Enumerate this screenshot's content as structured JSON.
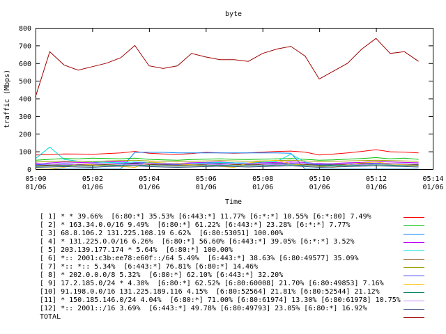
{
  "chart_data": {
    "type": "line",
    "title": "byte",
    "xlabel": "Time",
    "ylabel": "traffic (Mbps)",
    "ylim": [
      0,
      800
    ],
    "yticks": [
      "0",
      "100",
      "200",
      "300",
      "400",
      "500",
      "600",
      "700",
      "800"
    ],
    "xlim": [
      "05:00",
      "05:14"
    ],
    "xticks": [
      {
        "time": "05:00",
        "date": "01/06"
      },
      {
        "time": "05:02",
        "date": "01/06"
      },
      {
        "time": "05:04",
        "date": "01/06"
      },
      {
        "time": "05:06",
        "date": "01/06"
      },
      {
        "time": "05:08",
        "date": "01/06"
      },
      {
        "time": "05:10",
        "date": "01/06"
      },
      {
        "time": "05:12",
        "date": "01/06"
      },
      {
        "time": "05:14",
        "date": "01/06"
      }
    ],
    "grid": false,
    "legend_placement": "bottom",
    "x": [
      "05:00",
      "05:00:30",
      "05:01",
      "05:01:30",
      "05:02",
      "05:02:30",
      "05:03",
      "05:03:30",
      "05:04",
      "05:04:30",
      "05:05",
      "05:05:30",
      "05:06",
      "05:06:30",
      "05:07",
      "05:07:30",
      "05:08",
      "05:08:30",
      "05:09",
      "05:09:30",
      "05:10",
      "05:10:30",
      "05:11",
      "05:11:30",
      "05:12",
      "05:12:30",
      "05:13",
      "05:13:30"
    ],
    "series": [
      {
        "name": "[ 1] * * 39.66%  [6:80:*] 35.53% [6:443:*] 11.77% [6:*:*] 10.55% [6:*:80] 7.49%",
        "color": "#ff0000",
        "values": [
          80,
          82,
          86,
          85,
          84,
          88,
          92,
          100,
          90,
          86,
          83,
          88,
          95,
          92,
          90,
          92,
          96,
          100,
          102,
          96,
          80,
          85,
          92,
          100,
          110,
          98,
          96,
          92
        ]
      },
      {
        "name": "[ 2] * 163.34.0.0/16 9.49%  [6:80:*] 61.22% [6:443:*] 23.28% [6:*:*] 7.77%",
        "color": "#00c000",
        "values": [
          50,
          55,
          60,
          58,
          62,
          60,
          58,
          62,
          55,
          52,
          50,
          54,
          56,
          58,
          55,
          54,
          56,
          58,
          60,
          55,
          50,
          52,
          56,
          60,
          65,
          58,
          62,
          55
        ]
      },
      {
        "name": "[ 3] 68.8.106.2 131.225.108.19 6.62%  [6:80:53051] 100.00%",
        "color": "#0080ff",
        "values": [
          0,
          0,
          0,
          0,
          0,
          0,
          0,
          95,
          95,
          95,
          92,
          92,
          92,
          92,
          92,
          92,
          92,
          92,
          90,
          0,
          0,
          0,
          0,
          0,
          0,
          0,
          0,
          0
        ]
      },
      {
        "name": "[ 4] * 131.225.0.0/16 6.26%  [6:80:*] 56.60% [6:443:*] 39.05% [6:*:*] 3.52%",
        "color": "#c000ff",
        "values": [
          30,
          35,
          40,
          38,
          36,
          40,
          42,
          38,
          36,
          34,
          32,
          36,
          38,
          40,
          36,
          34,
          36,
          38,
          40,
          38,
          30,
          32,
          36,
          38,
          42,
          40,
          38,
          36
        ]
      },
      {
        "name": "[ 5] 203.139.177.174 * 5.64%  [6:80:*] 100.00%",
        "color": "#00e0e0",
        "values": [
          60,
          125,
          55,
          45,
          40,
          38,
          36,
          40,
          38,
          35,
          30,
          32,
          35,
          38,
          36,
          34,
          40,
          42,
          85,
          40,
          20,
          22,
          25,
          28,
          30,
          28,
          26,
          25
        ]
      },
      {
        "name": "[ 6] *:: 2001:c3b:ee78:e60f::/64 5.49%  [6:443:*] 38.63% [6:80:49577] 35.09%",
        "color": "#804000",
        "values": [
          20,
          22,
          25,
          24,
          22,
          26,
          28,
          30,
          26,
          24,
          22,
          24,
          26,
          28,
          26,
          24,
          26,
          28,
          30,
          26,
          22,
          24,
          26,
          28,
          30,
          28,
          26,
          24
        ]
      },
      {
        "name": "[ 7] *:: *:: 5.34%  [6:443:*] 76.81% [6:80:*] 14.46%",
        "color": "#a0a000",
        "values": [
          40,
          42,
          45,
          44,
          42,
          46,
          48,
          50,
          46,
          44,
          42,
          44,
          46,
          48,
          46,
          44,
          46,
          48,
          50,
          46,
          42,
          44,
          46,
          48,
          50,
          48,
          46,
          44
        ]
      },
      {
        "name": "[ 8] * 202.0.0.0/8 5.32%  [6:80:*] 62.10% [6:443:*] 32.20%",
        "color": "#4040ff",
        "values": [
          25,
          28,
          30,
          28,
          26,
          30,
          32,
          34,
          30,
          28,
          26,
          28,
          30,
          32,
          30,
          28,
          30,
          32,
          34,
          30,
          26,
          28,
          30,
          32,
          34,
          32,
          30,
          28
        ]
      },
      {
        "name": "[ 9] 17.2.185.0/24 * 4.30%  [6:80:*] 62.52% [6:80:60008] 21.70% [6:80:49853] 7.16%",
        "color": "#ffc000",
        "values": [
          0,
          0,
          10,
          30,
          25,
          20,
          15,
          10,
          40,
          35,
          30,
          25,
          20,
          15,
          10,
          35,
          45,
          50,
          30,
          20,
          15,
          10,
          25,
          35,
          40,
          30,
          25,
          20
        ]
      },
      {
        "name": "[10] 91.198.0.0/16 131.225.189.116 4.15%  [6:80:52564] 21.81% [6:80:52544] 21.12%",
        "color": "#008060",
        "values": [
          15,
          18,
          20,
          18,
          16,
          20,
          22,
          24,
          20,
          18,
          16,
          18,
          20,
          22,
          20,
          18,
          20,
          22,
          24,
          20,
          16,
          18,
          20,
          22,
          24,
          22,
          20,
          18
        ]
      },
      {
        "name": "[11] * 150.185.146.0/24 4.04%  [6:80:*] 71.00% [6:80:61974] 13.30% [6:80:61978] 10.75%",
        "color": "#c080ff",
        "values": [
          35,
          30,
          25,
          28,
          32,
          30,
          28,
          25,
          30,
          32,
          34,
          30,
          28,
          25,
          30,
          32,
          28,
          25,
          30,
          32,
          34,
          30,
          28,
          25,
          30,
          32,
          28,
          30
        ]
      },
      {
        "name": "[12] *:: 2001::/16 3.69%  [6:443:*] 49.78% [6:80:49793] 23.05% [6:80:*] 16.92%",
        "color": "#405080",
        "values": [
          10,
          12,
          14,
          12,
          10,
          14,
          16,
          18,
          14,
          12,
          10,
          12,
          14,
          16,
          14,
          12,
          14,
          16,
          18,
          14,
          10,
          12,
          14,
          16,
          18,
          16,
          14,
          12
        ]
      },
      {
        "name": "TOTAL",
        "color": "#a00000",
        "values": [
          410,
          665,
          590,
          560,
          580,
          600,
          630,
          700,
          585,
          570,
          585,
          655,
          635,
          620,
          620,
          610,
          655,
          680,
          695,
          640,
          510,
          555,
          600,
          680,
          740,
          655,
          665,
          610
        ]
      }
    ]
  }
}
